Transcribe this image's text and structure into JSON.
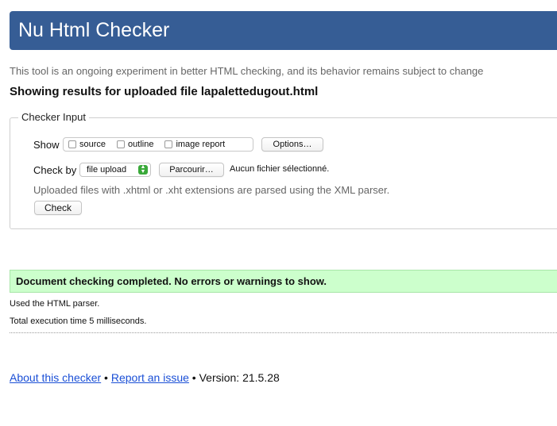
{
  "header": {
    "title": "Nu Html Checker"
  },
  "intro": "This tool is an ongoing experiment in better HTML checking, and its behavior remains subject to change",
  "results_heading": "Showing results for uploaded file lapalettedugout.html",
  "checker_input": {
    "legend": "Checker Input",
    "show_label": "Show",
    "show_options": [
      {
        "label": "source",
        "checked": false
      },
      {
        "label": "outline",
        "checked": false
      },
      {
        "label": "image report",
        "checked": false
      }
    ],
    "options_button": "Options…",
    "check_by_label": "Check by",
    "check_by_value": "file upload",
    "browse_button": "Parcourir…",
    "no_file_text": "Aucun fichier sélectionné.",
    "note": "Uploaded files with .xhtml or .xht extensions are parsed using the XML parser.",
    "check_button": "Check"
  },
  "result": {
    "success_message": "Document checking completed. No errors or warnings to show.",
    "parser_info": "Used the HTML parser.",
    "time_info": "Total execution time 5 milliseconds."
  },
  "footer": {
    "about_link": "About this checker",
    "sep1": " • ",
    "report_link": "Report an issue",
    "sep2": " • ",
    "version": "Version: 21.5.28"
  },
  "colors": {
    "header_bg": "#365d95",
    "success_bg": "#ccffcc",
    "link": "#1a4fd6",
    "select_arrow": "#3aa93a"
  },
  "icons": {
    "select_arrow": "updown-chevron-icon"
  }
}
